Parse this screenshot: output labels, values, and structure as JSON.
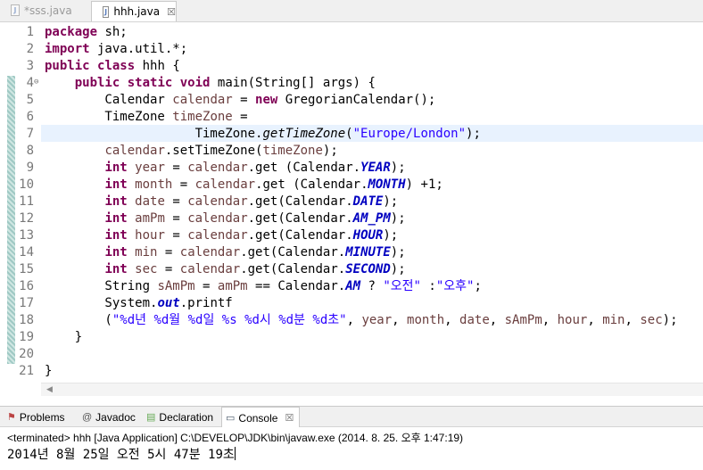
{
  "editor_tabs": [
    {
      "label": "*sss.java",
      "active": false
    },
    {
      "label": "hhh.java",
      "active": true,
      "close": "☒"
    }
  ],
  "code_lines": [
    {
      "n": "1",
      "tokens": [
        {
          "t": "kw",
          "v": "package"
        },
        {
          "t": "p",
          "v": " sh;"
        }
      ]
    },
    {
      "n": "2",
      "tokens": [
        {
          "t": "kw",
          "v": "import"
        },
        {
          "t": "p",
          "v": " java.util.*;"
        }
      ]
    },
    {
      "n": "3",
      "tokens": [
        {
          "t": "kw",
          "v": "public"
        },
        {
          "t": "p",
          "v": " "
        },
        {
          "t": "kw",
          "v": "class"
        },
        {
          "t": "p",
          "v": " hhh {"
        }
      ]
    },
    {
      "n": "4",
      "fold": "⊖",
      "tokens": [
        {
          "t": "p",
          "v": "    "
        },
        {
          "t": "kw",
          "v": "public"
        },
        {
          "t": "p",
          "v": " "
        },
        {
          "t": "kw",
          "v": "static"
        },
        {
          "t": "p",
          "v": " "
        },
        {
          "t": "kw",
          "v": "void"
        },
        {
          "t": "p",
          "v": " main(String[] args) {"
        }
      ]
    },
    {
      "n": "5",
      "tokens": [
        {
          "t": "p",
          "v": "        Calendar "
        },
        {
          "t": "var",
          "v": "calendar"
        },
        {
          "t": "p",
          "v": " = "
        },
        {
          "t": "kw",
          "v": "new"
        },
        {
          "t": "p",
          "v": " GregorianCalendar();"
        }
      ]
    },
    {
      "n": "6",
      "tokens": [
        {
          "t": "p",
          "v": "        TimeZone "
        },
        {
          "t": "var",
          "v": "timeZone"
        },
        {
          "t": "p",
          "v": " ="
        }
      ]
    },
    {
      "n": "7",
      "tokens": [
        {
          "t": "p",
          "v": "                    TimeZone."
        },
        {
          "t": "smeth",
          "v": "getTimeZone"
        },
        {
          "t": "p",
          "v": "("
        },
        {
          "t": "str",
          "v": "\"Europe/London\""
        },
        {
          "t": "p",
          "v": ");"
        }
      ]
    },
    {
      "n": "8",
      "tokens": [
        {
          "t": "p",
          "v": "        "
        },
        {
          "t": "var",
          "v": "calendar"
        },
        {
          "t": "p",
          "v": ".setTimeZone("
        },
        {
          "t": "var",
          "v": "timeZone"
        },
        {
          "t": "p",
          "v": ");"
        }
      ]
    },
    {
      "n": "9",
      "tokens": [
        {
          "t": "p",
          "v": "        "
        },
        {
          "t": "kw",
          "v": "int"
        },
        {
          "t": "p",
          "v": " "
        },
        {
          "t": "var",
          "v": "year"
        },
        {
          "t": "p",
          "v": " = "
        },
        {
          "t": "var",
          "v": "calendar"
        },
        {
          "t": "p",
          "v": ".get (Calendar."
        },
        {
          "t": "sfield",
          "v": "YEAR"
        },
        {
          "t": "p",
          "v": ");"
        }
      ]
    },
    {
      "n": "10",
      "tokens": [
        {
          "t": "p",
          "v": "        "
        },
        {
          "t": "kw",
          "v": "int"
        },
        {
          "t": "p",
          "v": " "
        },
        {
          "t": "var",
          "v": "month"
        },
        {
          "t": "p",
          "v": " = "
        },
        {
          "t": "var",
          "v": "calendar"
        },
        {
          "t": "p",
          "v": ".get (Calendar."
        },
        {
          "t": "sfield",
          "v": "MONTH"
        },
        {
          "t": "p",
          "v": ") +1;"
        }
      ]
    },
    {
      "n": "11",
      "tokens": [
        {
          "t": "p",
          "v": "        "
        },
        {
          "t": "kw",
          "v": "int"
        },
        {
          "t": "p",
          "v": " "
        },
        {
          "t": "var",
          "v": "date"
        },
        {
          "t": "p",
          "v": " = "
        },
        {
          "t": "var",
          "v": "calendar"
        },
        {
          "t": "p",
          "v": ".get(Calendar."
        },
        {
          "t": "sfield",
          "v": "DATE"
        },
        {
          "t": "p",
          "v": ");"
        }
      ]
    },
    {
      "n": "12",
      "tokens": [
        {
          "t": "p",
          "v": "        "
        },
        {
          "t": "kw",
          "v": "int"
        },
        {
          "t": "p",
          "v": " "
        },
        {
          "t": "var",
          "v": "amPm"
        },
        {
          "t": "p",
          "v": " = "
        },
        {
          "t": "var",
          "v": "calendar"
        },
        {
          "t": "p",
          "v": ".get(Calendar."
        },
        {
          "t": "sfield",
          "v": "AM_PM"
        },
        {
          "t": "p",
          "v": ");"
        }
      ]
    },
    {
      "n": "13",
      "tokens": [
        {
          "t": "p",
          "v": "        "
        },
        {
          "t": "kw",
          "v": "int"
        },
        {
          "t": "p",
          "v": " "
        },
        {
          "t": "var",
          "v": "hour"
        },
        {
          "t": "p",
          "v": " = "
        },
        {
          "t": "var",
          "v": "calendar"
        },
        {
          "t": "p",
          "v": ".get(Calendar."
        },
        {
          "t": "sfield",
          "v": "HOUR"
        },
        {
          "t": "p",
          "v": ");"
        }
      ]
    },
    {
      "n": "14",
      "tokens": [
        {
          "t": "p",
          "v": "        "
        },
        {
          "t": "kw",
          "v": "int"
        },
        {
          "t": "p",
          "v": " "
        },
        {
          "t": "var",
          "v": "min"
        },
        {
          "t": "p",
          "v": " = "
        },
        {
          "t": "var",
          "v": "calendar"
        },
        {
          "t": "p",
          "v": ".get(Calendar."
        },
        {
          "t": "sfield",
          "v": "MINUTE"
        },
        {
          "t": "p",
          "v": ");"
        }
      ]
    },
    {
      "n": "15",
      "tokens": [
        {
          "t": "p",
          "v": "        "
        },
        {
          "t": "kw",
          "v": "int"
        },
        {
          "t": "p",
          "v": " "
        },
        {
          "t": "var",
          "v": "sec"
        },
        {
          "t": "p",
          "v": " = "
        },
        {
          "t": "var",
          "v": "calendar"
        },
        {
          "t": "p",
          "v": ".get(Calendar."
        },
        {
          "t": "sfield",
          "v": "SECOND"
        },
        {
          "t": "p",
          "v": ");"
        }
      ]
    },
    {
      "n": "16",
      "tokens": [
        {
          "t": "p",
          "v": "        String "
        },
        {
          "t": "var",
          "v": "sAmPm"
        },
        {
          "t": "p",
          "v": " = "
        },
        {
          "t": "var",
          "v": "amPm"
        },
        {
          "t": "p",
          "v": " == Calendar."
        },
        {
          "t": "sfield",
          "v": "AM"
        },
        {
          "t": "p",
          "v": " ? "
        },
        {
          "t": "str",
          "v": "\"오전\""
        },
        {
          "t": "p",
          "v": " :"
        },
        {
          "t": "str",
          "v": "\"오후\""
        },
        {
          "t": "p",
          "v": ";"
        }
      ]
    },
    {
      "n": "17",
      "tokens": [
        {
          "t": "p",
          "v": "        System."
        },
        {
          "t": "sfield",
          "v": "out"
        },
        {
          "t": "p",
          "v": ".printf"
        }
      ]
    },
    {
      "n": "18",
      "tokens": [
        {
          "t": "p",
          "v": "        ("
        },
        {
          "t": "str",
          "v": "\"%d년 %d월 %d일 %s %d시 %d분 %d초\""
        },
        {
          "t": "p",
          "v": ", "
        },
        {
          "t": "var",
          "v": "year"
        },
        {
          "t": "p",
          "v": ", "
        },
        {
          "t": "var",
          "v": "month"
        },
        {
          "t": "p",
          "v": ", "
        },
        {
          "t": "var",
          "v": "date"
        },
        {
          "t": "p",
          "v": ", "
        },
        {
          "t": "var",
          "v": "sAmPm"
        },
        {
          "t": "p",
          "v": ", "
        },
        {
          "t": "var",
          "v": "hour"
        },
        {
          "t": "p",
          "v": ", "
        },
        {
          "t": "var",
          "v": "min"
        },
        {
          "t": "p",
          "v": ", "
        },
        {
          "t": "var",
          "v": "sec"
        },
        {
          "t": "p",
          "v": ");"
        }
      ]
    },
    {
      "n": "19",
      "tokens": [
        {
          "t": "p",
          "v": "    }"
        }
      ]
    },
    {
      "n": "20",
      "tokens": []
    },
    {
      "n": "21",
      "tokens": [
        {
          "t": "p",
          "v": "}"
        }
      ]
    }
  ],
  "views": {
    "problems": "Problems",
    "javadoc": "Javadoc",
    "declaration": "Declaration",
    "console": "Console",
    "console_close": "☒"
  },
  "console": {
    "status": "<terminated> hhh [Java Application] C:\\DEVELOP\\JDK\\bin\\javaw.exe (2014. 8. 25. 오후 1:47:19)",
    "output": "2014년 8월 25일 오전 5시 47분 19초"
  },
  "colors": {
    "keyword": "#7f0055",
    "local_variable": "#6a3e3e",
    "string": "#2a00ff",
    "static_field": "#0000c0",
    "current_line": "#e8f2fe"
  }
}
